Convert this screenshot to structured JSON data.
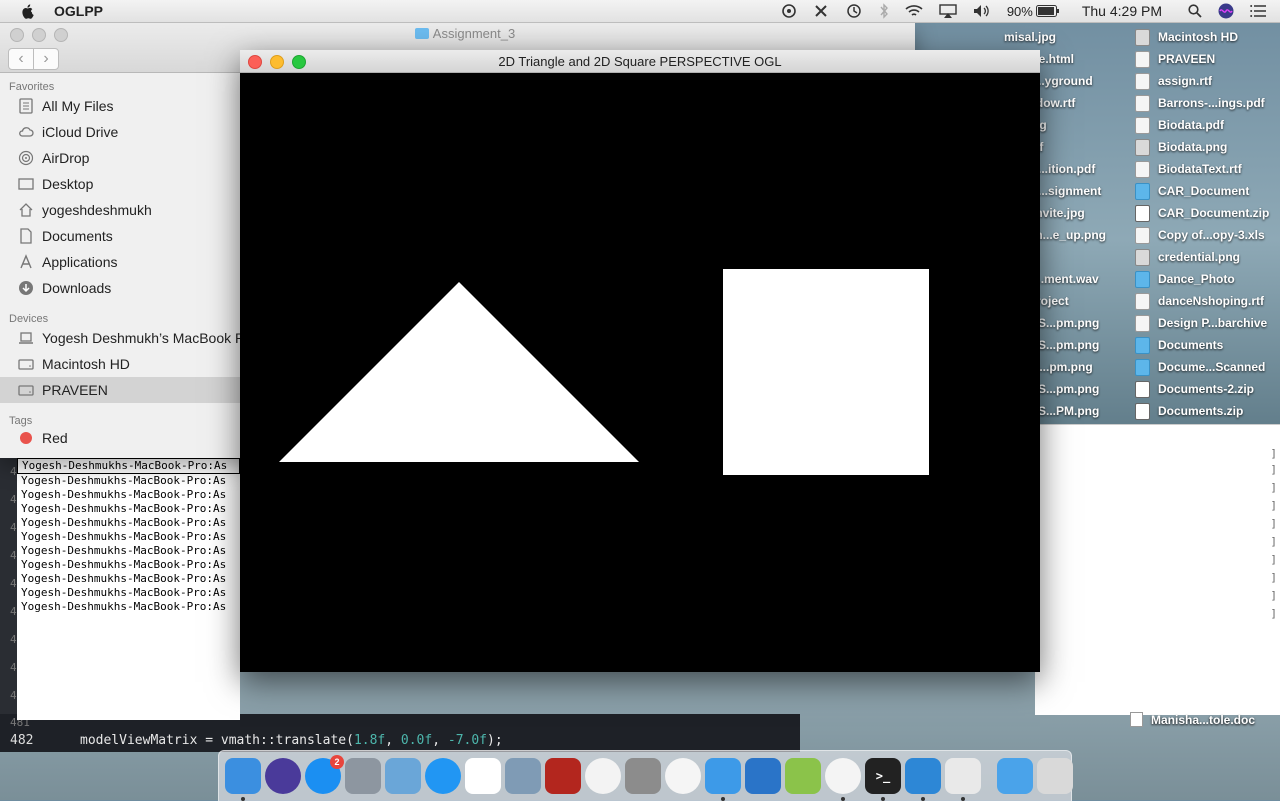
{
  "menubar": {
    "app_name": "OGLPP",
    "battery": "90%",
    "clock": "Thu 4:29 PM"
  },
  "finder": {
    "title": "Assignment_3",
    "favorites_header": "Favorites",
    "favorites": [
      {
        "label": "All My Files",
        "icon": "all-files-icon"
      },
      {
        "label": "iCloud Drive",
        "icon": "cloud-icon"
      },
      {
        "label": "AirDrop",
        "icon": "airdrop-icon"
      },
      {
        "label": "Desktop",
        "icon": "desktop-icon"
      },
      {
        "label": "yogeshdeshmukh",
        "icon": "home-icon"
      },
      {
        "label": "Documents",
        "icon": "documents-icon"
      },
      {
        "label": "Applications",
        "icon": "applications-icon"
      },
      {
        "label": "Downloads",
        "icon": "downloads-icon"
      }
    ],
    "devices_header": "Devices",
    "devices": [
      {
        "label": "Yogesh Deshmukh’s MacBook Pro",
        "icon": "laptop-icon"
      },
      {
        "label": "Macintosh HD",
        "icon": "disk-icon"
      },
      {
        "label": "PRAVEEN",
        "icon": "disk-icon"
      }
    ],
    "tags_header": "Tags",
    "tags": [
      {
        "label": "Red",
        "color": "#e9534c"
      }
    ]
  },
  "ogl_window": {
    "title": "2D Triangle and 2D Square PERSPECTIVE OGL"
  },
  "desktop_files": {
    "col1": [
      "misal.jpg",
      "...mage.html",
      "...ayg...yground",
      "...Window.rtf",
      "...n.png",
      "...ce.rtf",
      "...nGL...ition.pdf",
      "...nGL...signment",
      "...to_invite.jpg",
      "...to_in...e_up.png",
      "...jpg",
      "...ess...ment.wav",
      "...peProject",
      "...een S...pm.png",
      "...een S...pm.png",
      "...en S...pm.png",
      "...een S...pm.png",
      "...een S...PM.png"
    ],
    "col2": [
      {
        "label": "Macintosh HD",
        "kind": "disk"
      },
      {
        "label": "PRAVEEN",
        "kind": "file"
      },
      {
        "label": "assign.rtf",
        "kind": "file"
      },
      {
        "label": "Barrons-...ings.pdf",
        "kind": "file"
      },
      {
        "label": "Biodata.pdf",
        "kind": "file"
      },
      {
        "label": "Biodata.png",
        "kind": "img"
      },
      {
        "label": "BiodataText.rtf",
        "kind": "file"
      },
      {
        "label": "CAR_Document",
        "kind": "folder"
      },
      {
        "label": "CAR_Document.zip",
        "kind": "zip"
      },
      {
        "label": "Copy of...opy-3.xls",
        "kind": "file"
      },
      {
        "label": "credential.png",
        "kind": "img"
      },
      {
        "label": "Dance_Photo",
        "kind": "folder"
      },
      {
        "label": "danceNshoping.rtf",
        "kind": "file"
      },
      {
        "label": "Design P...barchive",
        "kind": "file"
      },
      {
        "label": "Documents",
        "kind": "folder"
      },
      {
        "label": "Docume...Scanned",
        "kind": "folder"
      },
      {
        "label": "Documents-2.zip",
        "kind": "zip"
      },
      {
        "label": "Documents.zip",
        "kind": "zip"
      }
    ],
    "bottom_item": "Manisha...tole.doc"
  },
  "terminal": {
    "lines": [
      "Yogesh-Deshmukhs-MacBook-Pro:As",
      "Yogesh-Deshmukhs-MacBook-Pro:As",
      "Yogesh-Deshmukhs-MacBook-Pro:As",
      "Yogesh-Deshmukhs-MacBook-Pro:As",
      "Yogesh-Deshmukhs-MacBook-Pro:As",
      "Yogesh-Deshmukhs-MacBook-Pro:As",
      "Yogesh-Deshmukhs-MacBook-Pro:As",
      "Yogesh-Deshmukhs-MacBook-Pro:As",
      "Yogesh-Deshmukhs-MacBook-Pro:As",
      "Yogesh-Deshmukhs-MacBook-Pro:As",
      "Yogesh-Deshmukhs-MacBook-Pro:As"
    ]
  },
  "editor": {
    "gutter": [
      "4",
      "4",
      "4",
      "4",
      "4",
      "4",
      "4",
      "4",
      "4",
      "4"
    ],
    "line_481": "481",
    "line_482": "482",
    "code_prefix": "modelViewMatrix = vmath::translate(",
    "arg1": "1.8f",
    "sep1": ", ",
    "arg2": "0.0f",
    "sep2": ", ",
    "arg3": "-7.0f",
    "code_suffix": ");"
  },
  "dock": {
    "app_store_badge": "2",
    "apps": [
      "finder-icon",
      "siri-icon",
      "app-store-icon",
      "launchpad-icon",
      "preview-icon",
      "safari-icon",
      "grid-app-icon",
      "image-capture-icon",
      "photo-booth-icon",
      "photos-icon",
      "system-preferences-icon",
      "itunes-icon",
      "xcode-files-icon",
      "ibooks-icon",
      "android-icon",
      "chrome-icon",
      "terminal-icon",
      "xcode-icon",
      "textedit-icon",
      "downloads-folder-icon",
      "trash-icon"
    ]
  }
}
